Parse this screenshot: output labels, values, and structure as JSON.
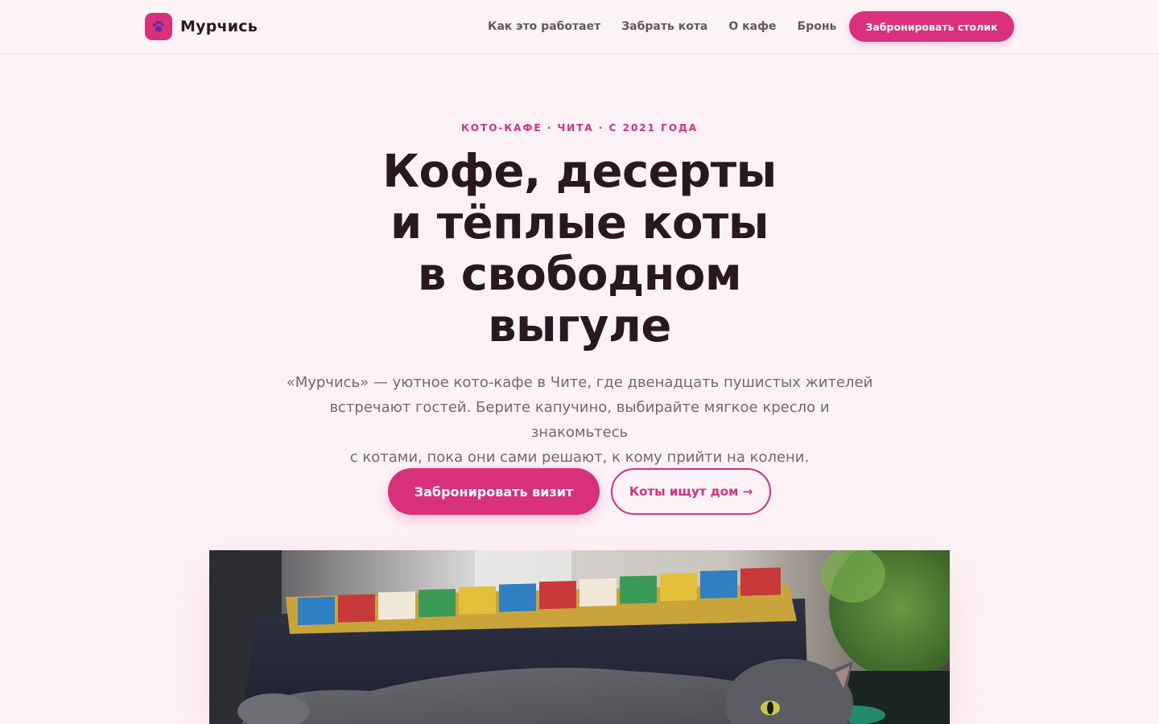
{
  "header": {
    "brand_name": "Мурчись",
    "brand_logo_icon": "paw-icon",
    "nav": [
      {
        "label": "Как это работает"
      },
      {
        "label": "Забрать кота"
      },
      {
        "label": "О кафе"
      },
      {
        "label": "Бронь"
      }
    ],
    "cta_label": "Забронировать столик"
  },
  "hero": {
    "eyebrow": "КОТО-КАФЕ · ЧИТА · С 2021 ГОДА",
    "title_lines": [
      "Кофе, десерты",
      "и тёплые коты",
      "в свободном",
      "выгуле"
    ],
    "subtitle_lines": [
      "«Мурчись» — уютное кото-кафе в Чите, где двенадцать пушистых жителей",
      "встречают гостей. Берите капучино, выбирайте мягкое кресло и знакомьтесь",
      "с котами, пока они сами решают, к кому прийти на колени."
    ],
    "primary_button": "Забронировать визит",
    "secondary_button": "Коты ищут дом →"
  },
  "photo": {
    "alt_icon": "cat-photo"
  },
  "colors": {
    "accent": "#d8307a",
    "background": "#fdf3f6",
    "text": "#2a1820",
    "muted": "#7a6570"
  }
}
